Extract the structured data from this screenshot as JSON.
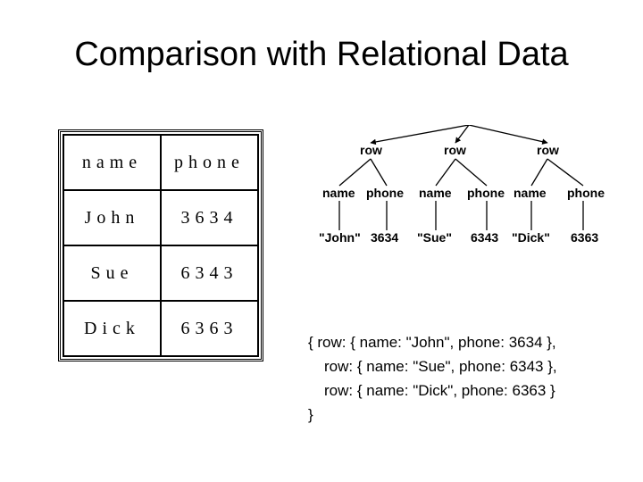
{
  "title": "Comparison with Relational Data",
  "table": {
    "headers": [
      "name",
      "phone"
    ],
    "rows": [
      {
        "name": "John",
        "phone": "3634"
      },
      {
        "name": "Sue",
        "phone": "6343"
      },
      {
        "name": "Dick",
        "phone": "6363"
      }
    ]
  },
  "tree": {
    "level1_label": "row",
    "level2_labels": [
      "name",
      "phone"
    ],
    "leaves": [
      {
        "name": "\"John\"",
        "phone": "3634"
      },
      {
        "name": "\"Sue\"",
        "phone": "6343"
      },
      {
        "name": "\"Dick\"",
        "phone": "6363"
      }
    ]
  },
  "json_text": {
    "open": "{ row: { name: \"John\", phone: 3634 },",
    "mid1": "row: { name: \"Sue\",   phone: 6343 },",
    "mid2": "row: { name: \"Dick\",  phone: 6363 }",
    "close": "}"
  }
}
